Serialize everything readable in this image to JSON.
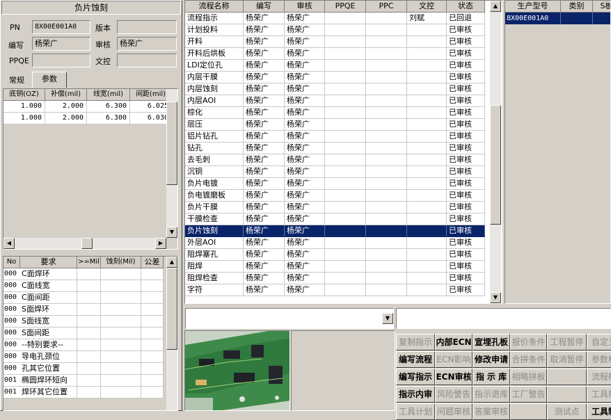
{
  "left": {
    "title": "负片蚀刻",
    "fields": {
      "pn_label": "PN",
      "pn_value": "8X00E001A0",
      "version_label": "版本",
      "version_value": "",
      "author_label": "编写",
      "author_value": "杨荣广",
      "review_label": "审核",
      "review_value": "杨荣广",
      "ppqe_label": "PPQE",
      "ppqe_value": "",
      "wenkong_label": "文控",
      "wenkong_value": ""
    },
    "tabs": [
      "常规",
      "参数"
    ],
    "params_table": {
      "columns": [
        "底铜(OZ)",
        "补偿(mil)",
        "线宽(mil)",
        "间距(mil)"
      ],
      "rows": [
        [
          "1.000",
          "2.000",
          "6.300",
          "6.025"
        ],
        [
          "1.000",
          "2.000",
          "6.300",
          "6.030"
        ]
      ]
    },
    "req_table": {
      "columns": [
        "No",
        "要求",
        ">=Mil",
        "蚀刻(Mil)",
        "公差"
      ],
      "rows": [
        [
          "000",
          "C面焊环"
        ],
        [
          "000",
          "C面线宽"
        ],
        [
          "000",
          "C面间距"
        ],
        [
          "000",
          "S面焊环"
        ],
        [
          "000",
          "S面线宽"
        ],
        [
          "000",
          "S面间距"
        ],
        [
          "000",
          "--特别要求--"
        ],
        [
          "000",
          "导电孔颈位"
        ],
        [
          "000",
          "孔其它位置"
        ],
        [
          "001",
          "椭圆焊环短向"
        ],
        [
          "001",
          "焊环其它位置"
        ]
      ]
    }
  },
  "process": {
    "columns": [
      "流程名称",
      "编写",
      "审核",
      "PPQE",
      "PPC",
      "文控",
      "状态"
    ],
    "selected_index": 18,
    "rows": [
      [
        "流程指示",
        "杨荣广",
        "杨荣广",
        "",
        "",
        "刘赋",
        "已回退"
      ],
      [
        "计划投料",
        "杨荣广",
        "杨荣广",
        "",
        "",
        "",
        "已审核"
      ],
      [
        "开料",
        "杨荣广",
        "杨荣广",
        "",
        "",
        "",
        "已审核"
      ],
      [
        "开料后烘板",
        "杨荣广",
        "杨荣广",
        "",
        "",
        "",
        "已审核"
      ],
      [
        "LDI定位孔",
        "杨荣广",
        "杨荣广",
        "",
        "",
        "",
        "已审核"
      ],
      [
        "内层干膜",
        "杨荣广",
        "杨荣广",
        "",
        "",
        "",
        "已审核"
      ],
      [
        "内层蚀刻",
        "杨荣广",
        "杨荣广",
        "",
        "",
        "",
        "已审核"
      ],
      [
        "内层AOI",
        "杨荣广",
        "杨荣广",
        "",
        "",
        "",
        "已审核"
      ],
      [
        "棕化",
        "杨荣广",
        "杨荣广",
        "",
        "",
        "",
        "已审核"
      ],
      [
        "层压",
        "杨荣广",
        "杨荣广",
        "",
        "",
        "",
        "已审核"
      ],
      [
        "铝片钻孔",
        "杨荣广",
        "杨荣广",
        "",
        "",
        "",
        "已审核"
      ],
      [
        "钻孔",
        "杨荣广",
        "杨荣广",
        "",
        "",
        "",
        "已审核"
      ],
      [
        "去毛刺",
        "杨荣广",
        "杨荣广",
        "",
        "",
        "",
        "已审核"
      ],
      [
        "沉铜",
        "杨荣广",
        "杨荣广",
        "",
        "",
        "",
        "已审核"
      ],
      [
        "负片电镀",
        "杨荣广",
        "杨荣广",
        "",
        "",
        "",
        "已审核"
      ],
      [
        "负电镀磨板",
        "杨荣广",
        "杨荣广",
        "",
        "",
        "",
        "已审核"
      ],
      [
        "负片干膜",
        "杨荣广",
        "杨荣广",
        "",
        "",
        "",
        "已审核"
      ],
      [
        "干膜检查",
        "杨荣广",
        "杨荣广",
        "",
        "",
        "",
        "已审核"
      ],
      [
        "负片蚀刻",
        "杨荣广",
        "杨荣广",
        "",
        "",
        "",
        "已审核"
      ],
      [
        "外层AOI",
        "杨荣广",
        "杨荣广",
        "",
        "",
        "",
        "已审核"
      ],
      [
        "阻焊塞孔",
        "杨荣广",
        "杨荣广",
        "",
        "",
        "",
        "已审核"
      ],
      [
        "阻焊",
        "杨荣广",
        "杨荣广",
        "",
        "",
        "",
        "已审核"
      ],
      [
        "阻焊检查",
        "杨荣广",
        "杨荣广",
        "",
        "",
        "",
        "已审核"
      ],
      [
        "字符",
        "杨荣广",
        "杨荣广",
        "",
        "",
        "",
        "已审核"
      ]
    ]
  },
  "right": {
    "columns": [
      "生产型号",
      "类别",
      "S板"
    ],
    "rows": [
      [
        "8X00E001A0",
        "",
        ""
      ]
    ]
  },
  "buttons": [
    [
      {
        "label": "复制指示",
        "enabled": false
      },
      {
        "label": "内部ECN",
        "enabled": true
      },
      {
        "label": "宣埋孔板",
        "enabled": true
      },
      {
        "label": "报价条件",
        "enabled": false
      },
      {
        "label": "工程暂停",
        "enabled": false
      },
      {
        "label": "自定义",
        "enabled": false
      }
    ],
    [
      {
        "label": "编写流程",
        "enabled": true
      },
      {
        "label": "ECN影响",
        "enabled": false
      },
      {
        "label": "修改申请",
        "enabled": true
      },
      {
        "label": "合拼条件",
        "enabled": false
      },
      {
        "label": "取消暂停",
        "enabled": false
      },
      {
        "label": "参数检",
        "enabled": false
      }
    ],
    [
      {
        "label": "编写指示",
        "enabled": true
      },
      {
        "label": "ECN审核",
        "enabled": true
      },
      {
        "label": "指 示 库",
        "enabled": true
      },
      {
        "label": "相略拼板",
        "enabled": false
      },
      {
        "label": "",
        "enabled": false
      },
      {
        "label": "流程检",
        "enabled": false
      }
    ],
    [
      {
        "label": "指示内审",
        "enabled": true
      },
      {
        "label": "风险警告",
        "enabled": false
      },
      {
        "label": "指示退库",
        "enabled": false
      },
      {
        "label": "工厂警告",
        "enabled": false
      },
      {
        "label": "",
        "enabled": false
      },
      {
        "label": "工具检",
        "enabled": false
      }
    ],
    [
      {
        "label": "工具计划",
        "enabled": false
      },
      {
        "label": "问题审核",
        "enabled": false
      },
      {
        "label": "答案审核",
        "enabled": false
      },
      {
        "label": "",
        "enabled": false
      },
      {
        "label": "测试点",
        "enabled": false
      },
      {
        "label": "工具制",
        "enabled": true
      }
    ]
  ]
}
